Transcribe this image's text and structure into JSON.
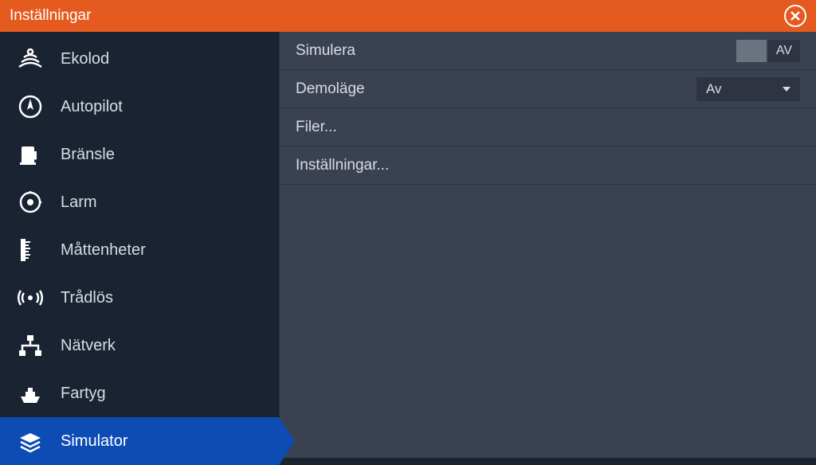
{
  "header": {
    "title": "Inställningar"
  },
  "sidebar": {
    "items": [
      {
        "label": "Ekolod",
        "icon": "sonar"
      },
      {
        "label": "Autopilot",
        "icon": "autopilot"
      },
      {
        "label": "Bränsle",
        "icon": "fuel"
      },
      {
        "label": "Larm",
        "icon": "alarm"
      },
      {
        "label": "Måttenheter",
        "icon": "units"
      },
      {
        "label": "Trådlös",
        "icon": "wireless"
      },
      {
        "label": "Nätverk",
        "icon": "network"
      },
      {
        "label": "Fartyg",
        "icon": "vessel"
      },
      {
        "label": "Simulator",
        "icon": "simulator",
        "active": true
      }
    ]
  },
  "main": {
    "rows": [
      {
        "label": "Simulera",
        "type": "toggle",
        "state": "AV"
      },
      {
        "label": "Demoläge",
        "type": "dropdown",
        "value": "Av"
      },
      {
        "label": "Filer...",
        "type": "link"
      },
      {
        "label": "Inställningar...",
        "type": "link"
      }
    ]
  }
}
